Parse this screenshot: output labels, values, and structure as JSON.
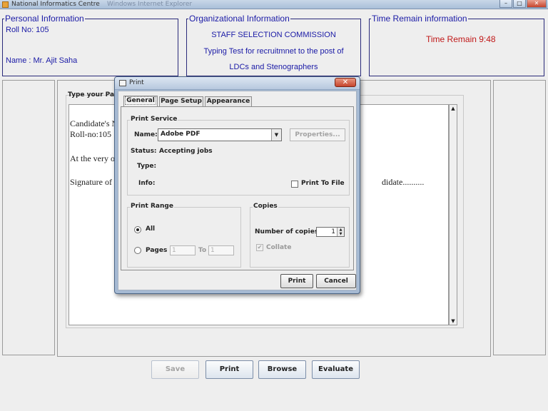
{
  "window": {
    "title": "National Informatics Centre",
    "faded_title": "Windows Internet Explorer",
    "min": "–",
    "max": "□",
    "close": "✕"
  },
  "personal": {
    "legend": "Personal Information",
    "roll": "Roll No: 105",
    "name": "Name : Mr. Ajit Saha"
  },
  "org": {
    "legend": "Organizational Information",
    "line1": "STAFF SELECTION COMMISSION",
    "line2": "Typing Test for recruitmnet to the post of",
    "line3": "LDCs and Stenographers"
  },
  "time": {
    "legend": "Time Remain information",
    "value": "Time Remain 9:48"
  },
  "editor": {
    "label": "Type your Para",
    "lines": [
      "Candidate's N",
      "Roll-no:105",
      "At the very ou",
      "Signature of I",
      "didate.........."
    ],
    "scroll_up": "▲",
    "scroll_down": "▼"
  },
  "buttons": {
    "save": "Save",
    "print": "Print",
    "browse": "Browse",
    "evaluate": "Evaluate"
  },
  "print_dialog": {
    "title": "Print",
    "close": "✕",
    "tabs": [
      "General",
      "Page Setup",
      "Appearance"
    ],
    "print_service": {
      "title": "Print Service",
      "name_label": "Name:",
      "name_value": "Adobe PDF",
      "dropdown_arrow": "▼",
      "properties": "Properties...",
      "status_label": "Status:",
      "status_value": "Accepting jobs",
      "type_label": "Type:",
      "info_label": "Info:",
      "print_to_file": "Print To File"
    },
    "print_range": {
      "title": "Print Range",
      "all": "All",
      "pages": "Pages",
      "from": "1",
      "to_label": "To",
      "to": "1"
    },
    "copies": {
      "title": "Copies",
      "number_label": "Number of copies:",
      "number": "1",
      "collate": "Collate",
      "check": "✔",
      "spin_up": "▲",
      "spin_down": "▼"
    },
    "print_button": "Print",
    "cancel_button": "Cancel"
  }
}
